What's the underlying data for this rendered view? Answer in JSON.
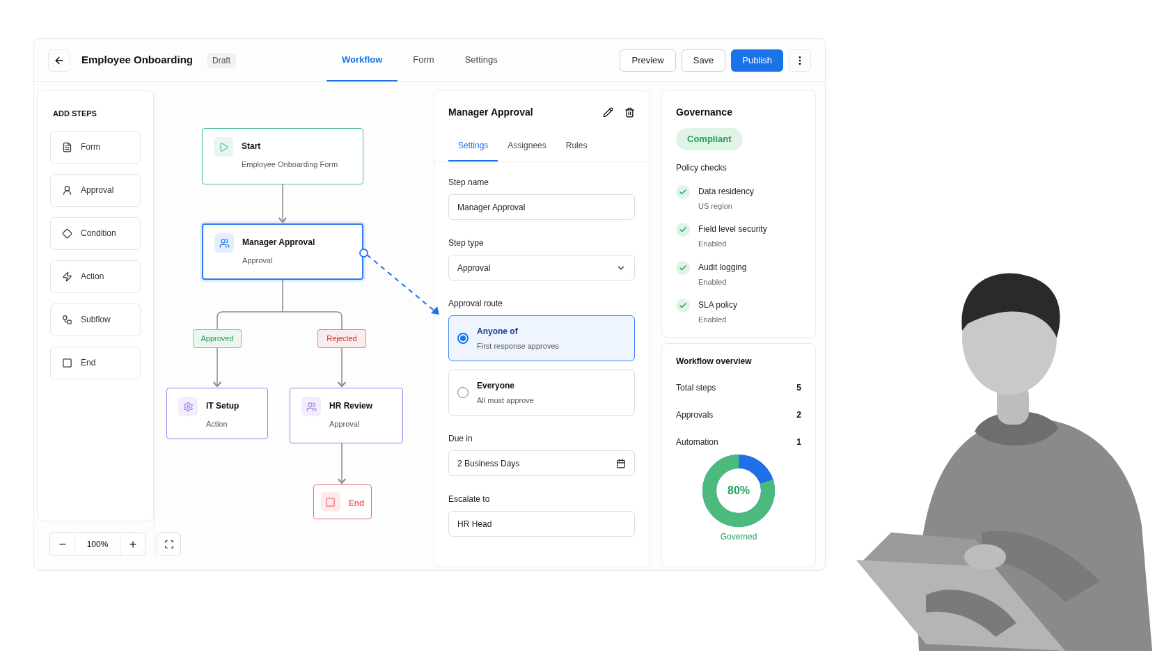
{
  "header": {
    "title": "Employee Onboarding",
    "status": "Draft",
    "tabs": [
      {
        "label": "Workflow",
        "selected": true
      },
      {
        "label": "Form",
        "selected": false
      },
      {
        "label": "Settings",
        "selected": false
      }
    ],
    "buttons": [
      {
        "label": "Preview",
        "kind": "secondary"
      },
      {
        "label": "Save",
        "kind": "secondary"
      },
      {
        "label": "Publish",
        "kind": "primary"
      }
    ]
  },
  "add_steps": {
    "title": "ADD STEPS",
    "items": [
      {
        "label": "Form"
      },
      {
        "label": "Approval"
      },
      {
        "label": "Condition"
      },
      {
        "label": "Action"
      },
      {
        "label": "Subflow"
      },
      {
        "label": "End"
      }
    ]
  },
  "canvas": {
    "nodes": [
      {
        "title": "Start",
        "subtitle": "Employee Onboarding Form",
        "color": "#4cc38a",
        "selected": false
      },
      {
        "title": "Manager Approval",
        "subtitle": "Approval",
        "color": "#2f7cf0",
        "selected": true
      },
      {
        "title": "IT Setup",
        "subtitle": "Action",
        "color": "#9b7cf0",
        "selected": false
      },
      {
        "title": "HR Review",
        "subtitle": "Approval",
        "color": "#9b7cf0",
        "selected": false
      },
      {
        "title": "End",
        "color": "#ef6b6b",
        "selected": false
      }
    ],
    "branches": [
      {
        "label": "Approved",
        "color": "#22a05a"
      },
      {
        "label": "Rejected",
        "color": "#dc2626"
      }
    ],
    "zoom": "100%"
  },
  "step_panel": {
    "title": "Manager Approval",
    "tabs": [
      {
        "label": "Settings",
        "selected": true
      },
      {
        "label": "Assignees",
        "selected": false
      },
      {
        "label": "Rules",
        "selected": false
      }
    ],
    "step_name": {
      "label": "Step name",
      "value": "Manager Approval"
    },
    "step_type": {
      "label": "Step type",
      "value": "Approval"
    },
    "approval_route": {
      "label": "Approval route",
      "options": [
        {
          "title": "Anyone of",
          "detail": "First response approves",
          "selected": true
        },
        {
          "title": "Everyone",
          "detail": "All must approve",
          "selected": false
        }
      ]
    },
    "due_in": {
      "label": "Due in",
      "value": "2 Business Days"
    },
    "escalate_to": {
      "label": "Escalate to",
      "value": "HR Head"
    }
  },
  "governance": {
    "title": "Governance",
    "status": "Compliant",
    "checks_title": "Policy checks",
    "checks": [
      {
        "name": "Data residency",
        "detail": "US region",
        "passed": true
      },
      {
        "name": "Field level security",
        "detail": "Enabled",
        "passed": true
      },
      {
        "name": "Audit logging",
        "detail": "Enabled",
        "passed": true
      },
      {
        "name": "SLA policy",
        "detail": "Enabled",
        "passed": true
      }
    ]
  },
  "overview": {
    "title": "Workflow overview",
    "stats": [
      {
        "label": "Total steps",
        "value": "5"
      },
      {
        "label": "Approvals",
        "value": "2"
      },
      {
        "label": "Automation",
        "value": "1"
      }
    ],
    "gauge": {
      "level": 0.8,
      "reading": "80%",
      "label": "Governed"
    }
  }
}
